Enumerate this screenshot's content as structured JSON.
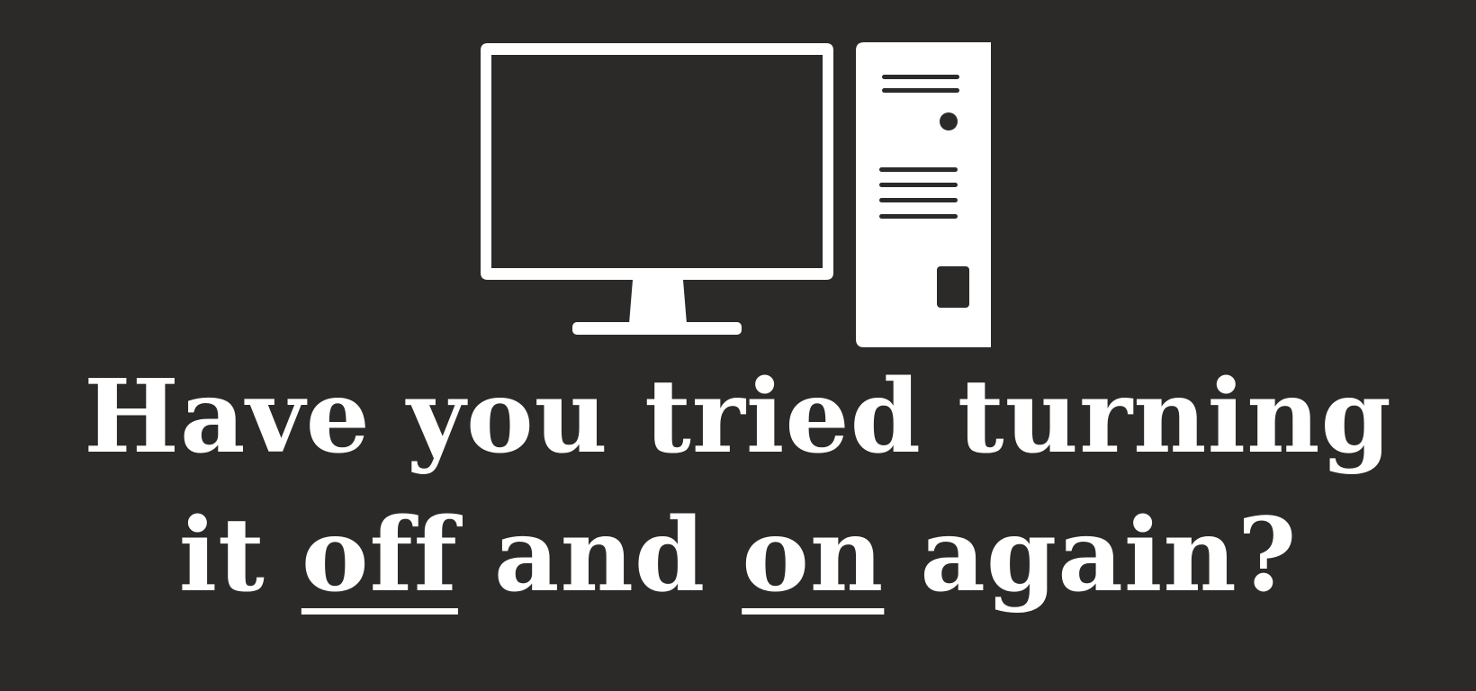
{
  "headline": {
    "line1": "Have you tried turning",
    "line2": {
      "w1": "it",
      "w2": "off",
      "w3": "and",
      "w4": "on",
      "w5": "again?"
    }
  },
  "icons": [
    "monitor-icon",
    "computer-tower-icon"
  ],
  "colors": {
    "background": "#2b2a29",
    "foreground": "#ffffff"
  }
}
